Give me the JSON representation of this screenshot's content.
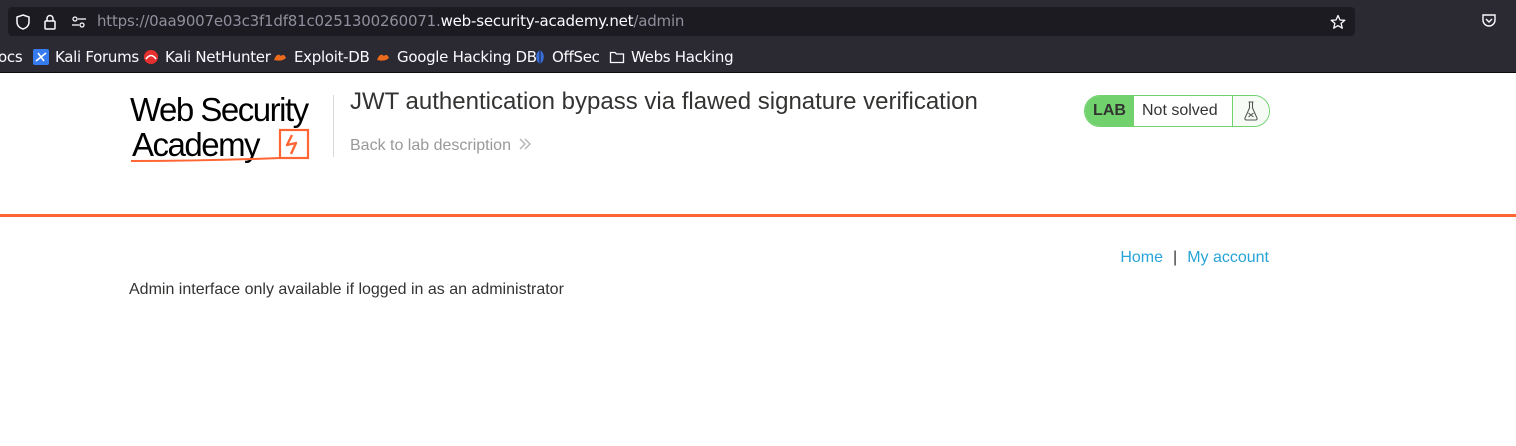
{
  "browser": {
    "url_prefix": "https://0aa9007e03c3f1df81c0251300260071.",
    "url_domain": "web-security-academy.net",
    "url_path": "/admin",
    "bookmarks": [
      {
        "label": "ocs",
        "icon": "truncated"
      },
      {
        "label": "Kali Forums",
        "icon": "kali-forums-icon"
      },
      {
        "label": "Kali NetHunter",
        "icon": "kali-nethunter-icon"
      },
      {
        "label": "Exploit-DB",
        "icon": "exploit-db-icon"
      },
      {
        "label": "Google Hacking DB",
        "icon": "ghdb-icon"
      },
      {
        "label": "OffSec",
        "icon": "offsec-icon"
      },
      {
        "label": "Webs Hacking",
        "icon": "folder-icon"
      }
    ]
  },
  "header": {
    "logo_line1": "Web Security",
    "logo_line2": "Academy",
    "lab_title": "JWT authentication bypass via flawed signature verification",
    "back_link": "Back to lab description",
    "status_lab": "LAB",
    "status_text": "Not solved",
    "colors": {
      "accent": "#ff6633",
      "status_green": "#70d16d",
      "link": "#29a3d6"
    }
  },
  "nav": {
    "home": "Home",
    "separator": "|",
    "account": "My account"
  },
  "main": {
    "message": "Admin interface only available if logged in as an administrator"
  }
}
